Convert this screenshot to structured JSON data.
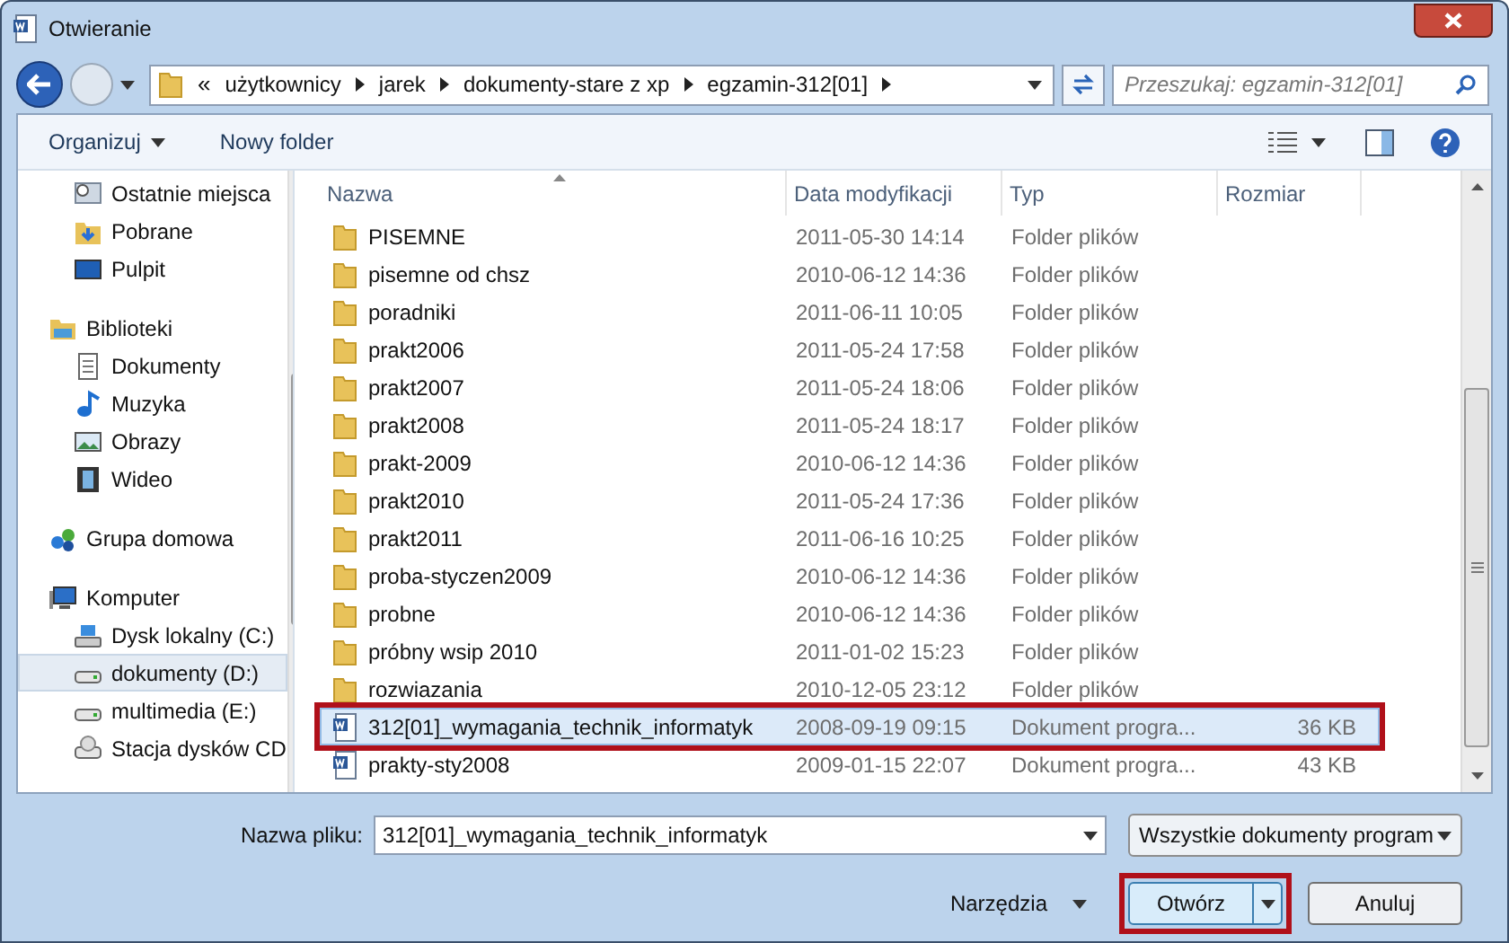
{
  "window": {
    "title": "Otwieranie"
  },
  "address": {
    "overflow": "«",
    "crumbs": [
      "użytkownicy",
      "jarek",
      "dokumenty-stare z xp",
      "egzamin-312[01]"
    ]
  },
  "search": {
    "placeholder": "Przeszukaj: egzamin-312[01]"
  },
  "toolbar": {
    "organize": "Organizuj",
    "new_folder": "Nowy folder"
  },
  "sidebar": {
    "items": [
      {
        "label": "Ostatnie miejsca",
        "kind": "recent",
        "indented": true,
        "selected": false
      },
      {
        "label": "Pobrane",
        "kind": "download",
        "indented": true,
        "selected": false
      },
      {
        "label": "Pulpit",
        "kind": "desktop",
        "indented": true,
        "selected": false
      },
      {
        "label": "Biblioteki",
        "kind": "library",
        "indented": false,
        "selected": false
      },
      {
        "label": "Dokumenty",
        "kind": "document",
        "indented": true,
        "selected": false
      },
      {
        "label": "Muzyka",
        "kind": "music",
        "indented": true,
        "selected": false
      },
      {
        "label": "Obrazy",
        "kind": "picture",
        "indented": true,
        "selected": false
      },
      {
        "label": "Wideo",
        "kind": "video",
        "indented": true,
        "selected": false
      },
      {
        "label": "Grupa domowa",
        "kind": "homegroup",
        "indented": false,
        "selected": false
      },
      {
        "label": "Komputer",
        "kind": "computer",
        "indented": false,
        "selected": false
      },
      {
        "label": "Dysk lokalny (C:)",
        "kind": "systemdrive",
        "indented": true,
        "selected": false
      },
      {
        "label": "dokumenty (D:)",
        "kind": "drive",
        "indented": true,
        "selected": true
      },
      {
        "label": "multimedia (E:)",
        "kind": "drive",
        "indented": true,
        "selected": false
      },
      {
        "label": "Stacja dysków CD",
        "kind": "cd",
        "indented": true,
        "selected": false
      }
    ]
  },
  "table": {
    "columns": [
      "Nazwa",
      "Data modyfikacji",
      "Typ",
      "Rozmiar"
    ],
    "rows": [
      {
        "kind": "folder",
        "name": "PISEMNE",
        "date": "2011-05-30 14:14",
        "type": "Folder plików",
        "selected": false,
        "highlighted": false
      },
      {
        "kind": "folder",
        "name": "pisemne od chsz",
        "date": "2010-06-12 14:36",
        "type": "Folder plików",
        "selected": false,
        "highlighted": false
      },
      {
        "kind": "folder",
        "name": "poradniki",
        "date": "2011-06-11 10:05",
        "type": "Folder plików",
        "selected": false,
        "highlighted": false
      },
      {
        "kind": "folder",
        "name": "prakt2006",
        "date": "2011-05-24 17:58",
        "type": "Folder plików",
        "selected": false,
        "highlighted": false
      },
      {
        "kind": "folder",
        "name": "prakt2007",
        "date": "2011-05-24 18:06",
        "type": "Folder plików",
        "selected": false,
        "highlighted": false
      },
      {
        "kind": "folder",
        "name": "prakt2008",
        "date": "2011-05-24 18:17",
        "type": "Folder plików",
        "selected": false,
        "highlighted": false
      },
      {
        "kind": "folder",
        "name": "prakt-2009",
        "date": "2010-06-12 14:36",
        "type": "Folder plików",
        "selected": false,
        "highlighted": false
      },
      {
        "kind": "folder",
        "name": "prakt2010",
        "date": "2011-05-24 17:36",
        "type": "Folder plików",
        "selected": false,
        "highlighted": false
      },
      {
        "kind": "folder",
        "name": "prakt2011",
        "date": "2011-06-16 10:25",
        "type": "Folder plików",
        "selected": false,
        "highlighted": false
      },
      {
        "kind": "folder",
        "name": "proba-styczen2009",
        "date": "2010-06-12 14:36",
        "type": "Folder plików",
        "selected": false,
        "highlighted": false
      },
      {
        "kind": "folder",
        "name": "probne",
        "date": "2010-06-12 14:36",
        "type": "Folder plików",
        "selected": false,
        "highlighted": false
      },
      {
        "kind": "folder",
        "name": "próbny wsip 2010",
        "date": "2011-01-02 15:23",
        "type": "Folder plików",
        "selected": false,
        "highlighted": false
      },
      {
        "kind": "folder",
        "name": "rozwiazania",
        "date": "2010-12-05 23:12",
        "type": "Folder plików",
        "selected": false,
        "highlighted": false
      },
      {
        "kind": "doc",
        "name": "312[01]_wymagania_technik_informatyk",
        "date": "2008-09-19 09:15",
        "type": "Dokument progra...",
        "size": "36 KB",
        "selected": true,
        "highlighted": true
      },
      {
        "kind": "doc",
        "name": "prakty-sty2008",
        "date": "2009-01-15 22:07",
        "type": "Dokument progra...",
        "size": "43 KB",
        "selected": false,
        "highlighted": false
      }
    ]
  },
  "footer": {
    "filename_label": "Nazwa pliku:",
    "filename": "312[01]_wymagania_technik_informatyk",
    "filter": "Wszystkie dokumenty program",
    "tools": "Narzędzia",
    "open": {
      "label": "Otwórz",
      "highlighted": true
    },
    "cancel": "Anuluj"
  }
}
